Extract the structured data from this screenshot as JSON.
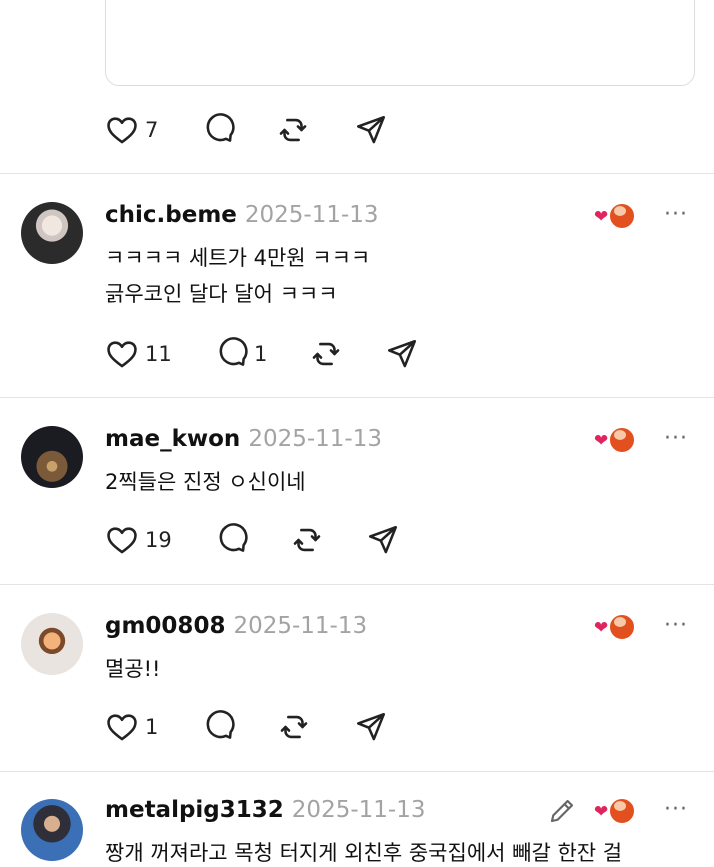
{
  "top_post": {
    "likes": "7"
  },
  "comments": [
    {
      "username": "chic.beme",
      "date": "2025-11-13",
      "lines": [
        "ㅋㅋㅋㅋ 세트가 4만원 ㅋㅋㅋ",
        "긁우코인 달다 달어 ㅋㅋㅋ"
      ],
      "likes": "11",
      "replies": "1"
    },
    {
      "username": "mae_kwon",
      "date": "2025-11-13",
      "lines": [
        "2찍들은 진정 ㅇ신이네"
      ],
      "likes": "19",
      "replies": ""
    },
    {
      "username": "gm00808",
      "date": "2025-11-13",
      "lines": [
        "멸공!!"
      ],
      "likes": "1",
      "replies": ""
    },
    {
      "username": "metalpig3132",
      "date": "2025-11-13",
      "lines": [
        "짱개 꺼져라고 목청 터지게 외친후 중국집에서 빼갈 한잔 걸"
      ],
      "likes": "",
      "replies": ""
    }
  ],
  "icons": {
    "like": "heart-outline-icon",
    "reply": "speech-bubble-icon",
    "repost": "repost-icon",
    "share": "send-icon",
    "more": "more-dots-icon",
    "reaction": "liked-by-author-icon",
    "edit": "pencil-icon"
  },
  "colors": {
    "heart_red": "#e0245e",
    "date_gray": "#a3a3a3",
    "divider": "#e4e4e4"
  },
  "more_glyph": "···"
}
